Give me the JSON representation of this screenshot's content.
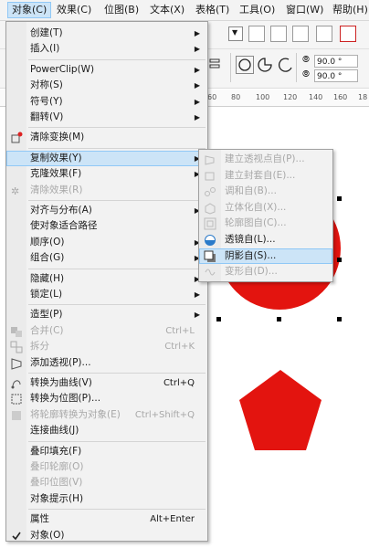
{
  "menubar": [
    "对象(C)",
    "效果(C)",
    "位图(B)",
    "文本(X)",
    "表格(T)",
    "工具(O)",
    "窗口(W)",
    "帮助(H)"
  ],
  "toolbar": {
    "angle1": "90.0 °",
    "angle2": "90.0 °"
  },
  "ruler": [
    "60",
    "80",
    "100",
    "120",
    "140",
    "160",
    "18"
  ],
  "main_menu": [
    {
      "label": "创建(T)",
      "arrow": true,
      "icon": "blank"
    },
    {
      "label": "插入(I)",
      "arrow": true,
      "icon": "blank"
    },
    {
      "sep": true
    },
    {
      "label": "PowerClip(W)",
      "arrow": true,
      "icon": "blank"
    },
    {
      "label": "对称(S)",
      "arrow": true,
      "icon": "blank"
    },
    {
      "label": "符号(Y)",
      "arrow": true,
      "icon": "blank"
    },
    {
      "label": "翻转(V)",
      "arrow": true,
      "icon": "blank"
    },
    {
      "sep": true
    },
    {
      "label": "清除变换(M)",
      "icon": "clear-transform-icon"
    },
    {
      "sep": true
    },
    {
      "label": "复制效果(Y)",
      "arrow": true,
      "highlight": true,
      "icon": "blank"
    },
    {
      "label": "克隆效果(F)",
      "arrow": true,
      "icon": "blank"
    },
    {
      "label": "清除效果(R)",
      "disabled": true,
      "icon": "clear-effect-icon"
    },
    {
      "sep": true
    },
    {
      "label": "对齐与分布(A)",
      "arrow": true,
      "icon": "blank"
    },
    {
      "label": "使对象适合路径",
      "icon": "blank"
    },
    {
      "label": "顺序(O)",
      "arrow": true,
      "icon": "blank"
    },
    {
      "label": "组合(G)",
      "arrow": true,
      "icon": "blank"
    },
    {
      "sep": true
    },
    {
      "label": "隐藏(H)",
      "arrow": true,
      "icon": "blank"
    },
    {
      "label": "锁定(L)",
      "arrow": true,
      "icon": "blank"
    },
    {
      "sep": true
    },
    {
      "label": "造型(P)",
      "arrow": true,
      "icon": "blank"
    },
    {
      "label": "合并(C)",
      "shortcut": "Ctrl+L",
      "disabled": true,
      "icon": "combine-icon"
    },
    {
      "label": "拆分",
      "shortcut": "Ctrl+K",
      "disabled": true,
      "icon": "break-apart-icon"
    },
    {
      "label": "添加透视(P)...",
      "icon": "perspective-icon"
    },
    {
      "sep": true
    },
    {
      "label": "转换为曲线(V)",
      "shortcut": "Ctrl+Q",
      "icon": "convert-curves-icon"
    },
    {
      "label": "转换为位图(P)...",
      "icon": "convert-bitmap-icon"
    },
    {
      "label": "将轮廓转换为对象(E)",
      "shortcut": "Ctrl+Shift+Q",
      "disabled": true,
      "icon": "outline-object-icon"
    },
    {
      "label": "连接曲线(J)",
      "icon": "blank"
    },
    {
      "sep": true
    },
    {
      "label": "叠印填充(F)",
      "icon": "blank"
    },
    {
      "label": "叠印轮廓(O)",
      "disabled": true,
      "icon": "blank"
    },
    {
      "label": "叠印位图(V)",
      "disabled": true,
      "icon": "blank"
    },
    {
      "label": "对象提示(H)",
      "icon": "blank"
    },
    {
      "sep": true
    },
    {
      "label": "属性",
      "shortcut": "Alt+Enter",
      "icon": "blank"
    },
    {
      "label": "对象(O)",
      "icon": "check-icon"
    }
  ],
  "sub_menu": [
    {
      "label": "建立透视点自(P)...",
      "disabled": true,
      "icon": "perspective-from-icon"
    },
    {
      "label": "建立封套自(E)...",
      "disabled": true,
      "icon": "envelope-from-icon"
    },
    {
      "label": "调和自(B)...",
      "disabled": true,
      "icon": "blend-from-icon"
    },
    {
      "label": "立体化自(X)...",
      "disabled": true,
      "icon": "extrude-from-icon"
    },
    {
      "label": "轮廓图自(C)...",
      "disabled": true,
      "icon": "contour-from-icon"
    },
    {
      "label": "透镜自(L)...",
      "icon": "lens-from-icon"
    },
    {
      "label": "阴影自(S)...",
      "highlight": true,
      "icon": "shadow-from-icon"
    },
    {
      "label": "变形自(D)...",
      "disabled": true,
      "icon": "distort-from-icon"
    }
  ],
  "colors": {
    "shape_red": "#e3140f",
    "highlight": "#cce4f7",
    "menu_bg": "#f2f2f2"
  }
}
